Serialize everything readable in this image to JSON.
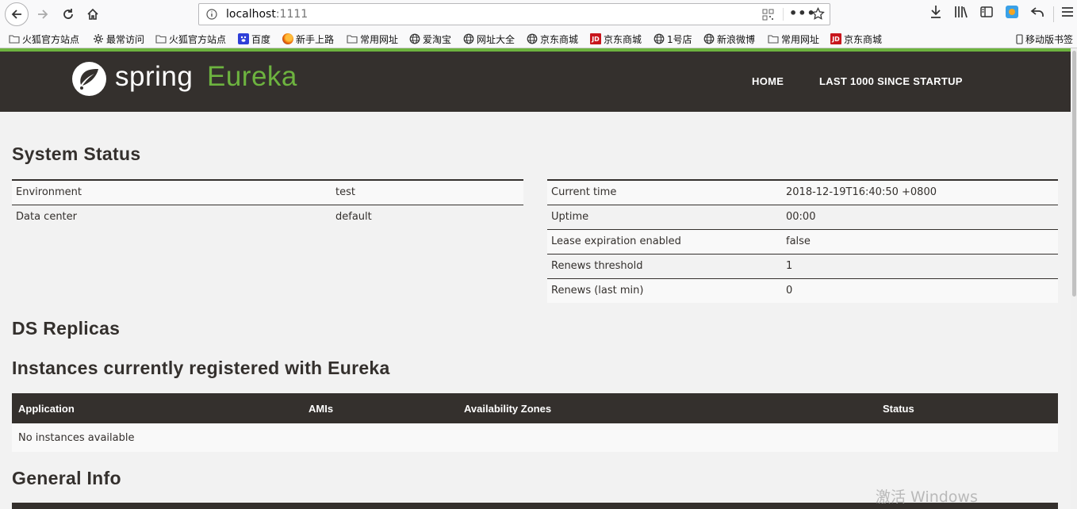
{
  "browser": {
    "url_host": "localhost",
    "url_port": ":1111",
    "bookmarks": [
      {
        "label": "火狐官方站点",
        "icon": "folder-icon"
      },
      {
        "label": "最常访问",
        "icon": "gear-icon"
      },
      {
        "label": "火狐官方站点",
        "icon": "folder-icon"
      },
      {
        "label": "百度",
        "icon": "baidu-icon"
      },
      {
        "label": "新手上路",
        "icon": "firefox-icon"
      },
      {
        "label": "常用网址",
        "icon": "folder-icon"
      },
      {
        "label": "爱淘宝",
        "icon": "globe-icon"
      },
      {
        "label": "网址大全",
        "icon": "globe-icon"
      },
      {
        "label": "京东商城",
        "icon": "globe-icon"
      },
      {
        "label": "京东商城",
        "icon": "jd-icon"
      },
      {
        "label": "1号店",
        "icon": "globe-icon"
      },
      {
        "label": "新浪微博",
        "icon": "globe-icon"
      },
      {
        "label": "常用网址",
        "icon": "folder-icon"
      },
      {
        "label": "京东商城",
        "icon": "jd-icon"
      }
    ],
    "mobile_bookmarks": "移动版书签",
    "jd_icon_text": "JD"
  },
  "brand": {
    "spring": "spring",
    "eureka": "Eureka",
    "accent_color": "#6db33f",
    "nav_bg": "#34302d"
  },
  "nav": {
    "home": "HOME",
    "last1000": "LAST 1000 SINCE STARTUP"
  },
  "system_status": {
    "title": "System Status",
    "left": [
      {
        "label": "Environment",
        "value": "test"
      },
      {
        "label": "Data center",
        "value": "default"
      }
    ],
    "right": [
      {
        "label": "Current time",
        "value": "2018-12-19T16:40:50 +0800"
      },
      {
        "label": "Uptime",
        "value": "00:00"
      },
      {
        "label": "Lease expiration enabled",
        "value": "false"
      },
      {
        "label": "Renews threshold",
        "value": "1"
      },
      {
        "label": "Renews (last min)",
        "value": "0"
      }
    ]
  },
  "ds_replicas": {
    "title": "DS Replicas"
  },
  "instances": {
    "title": "Instances currently registered with Eureka",
    "columns": [
      "Application",
      "AMIs",
      "Availability Zones",
      "Status"
    ],
    "empty_text": "No instances available"
  },
  "general_info": {
    "title": "General Info"
  },
  "watermark": "激活 Windows"
}
